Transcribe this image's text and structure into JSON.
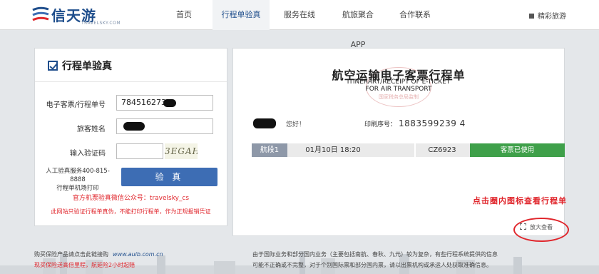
{
  "header": {
    "logo_text": "信天游",
    "logo_sub": "TRAVELSKY.COM",
    "nav": [
      {
        "label": "首页"
      },
      {
        "label": "行程单验真"
      },
      {
        "label": "服务在线"
      },
      {
        "label": "航旅聚合APP"
      },
      {
        "label": "合作联系"
      }
    ],
    "right_link": "精彩旅游"
  },
  "form": {
    "title": "行程单验真",
    "ticket_label": "电子客票/行程单号",
    "ticket_value": "7845162737",
    "name_label": "旅客姓名",
    "captcha_label": "输入验证码",
    "captcha_image_text": "3EGAH",
    "service_line1": "人工验真服务400-815-8888",
    "service_line2": "行程单机场打印",
    "verify_button": "验 真",
    "wechat_note": "官方机票验真微信公众号：travelsky_cs",
    "warning_note": "此网站只验证行程单真伪，不能打印行程单，作为正规报销凭证"
  },
  "itinerary": {
    "title": "航空运输电子客票行程单",
    "subtitle_line1": "ITINERARY/RECEIPT OF E-TICKET",
    "subtitle_line2": "FOR AIR TRANSPORT",
    "stamp_text": "国家税务总局监制",
    "greeting": "您好！",
    "print_label": "印刷序号：",
    "print_number": "1883599239  4",
    "flight": {
      "segment": "航段1",
      "date": "01月10日 18:20",
      "flight_no": "CZ6923",
      "status": "客票已使用"
    },
    "annotation": "点击圈内图标查看行程单",
    "zoom_label": "放大查看"
  },
  "footer": {
    "left_line1": "购买保险产品请点击此链接购",
    "left_site": "www.auib.com.cn",
    "left_line2": "现买保险送高倍里程，航延险2小时起赔",
    "right_line1": "由于国际业务和部分国内业务（主要包括南航、春秋、九元）较为复杂，有些行程系统提供的信息",
    "right_line2": "可能不正确或不完整，对于个别国际票和部分国内票，请以出票机构或承运人处获取准确信息。"
  },
  "colors": {
    "brand_blue": "#1f4e8c",
    "button_blue": "#3d6db4",
    "status_green": "#3fa04a",
    "alert_red": "#e0262c"
  }
}
